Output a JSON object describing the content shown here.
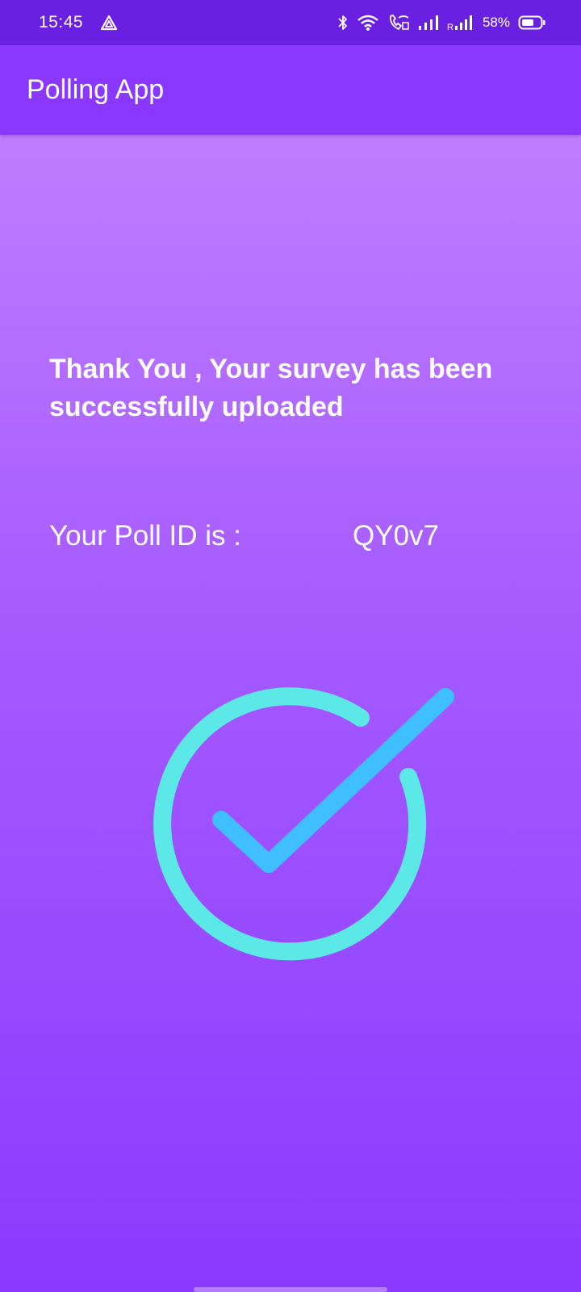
{
  "status_bar": {
    "time": "15:45",
    "battery_percent": "58%",
    "icons": [
      "navigation-icon",
      "bluetooth-icon",
      "wifi-icon",
      "wifi-calling-icon",
      "signal-icon",
      "roaming-signal-icon",
      "battery-icon"
    ]
  },
  "app_bar": {
    "title": "Polling App"
  },
  "main": {
    "message": "Thank You , Your survey has been successfully uploaded",
    "poll_id_label": "Your Poll ID is :",
    "poll_id_value": "QY0v7",
    "success_icon": "check-circle-icon"
  },
  "colors": {
    "status_bar": "#6a20e0",
    "app_bar": "#8a38ff",
    "gradient_top": "#bf7dff",
    "gradient_bottom": "#8a3aff",
    "circle": "#5ce8e6",
    "check": "#3fbfff",
    "text": "#ffffff"
  }
}
